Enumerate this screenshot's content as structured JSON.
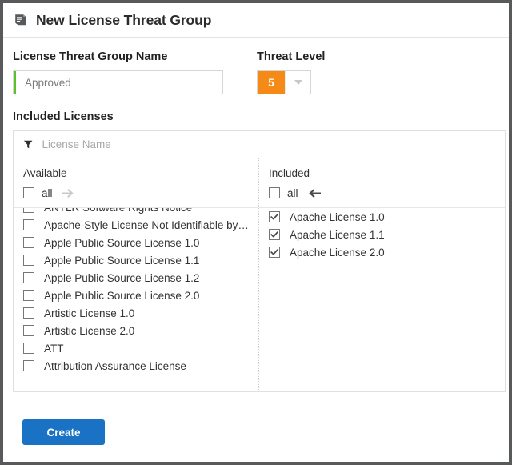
{
  "window": {
    "title": "New License Threat Group",
    "title_icon": "book-icon"
  },
  "form": {
    "name_field": {
      "label": "License Threat Group Name",
      "value": "Approved",
      "placeholder": "",
      "validity_color": "#5cc12c"
    },
    "threat_level": {
      "label": "Threat Level",
      "value": "5",
      "badge_color": "#f68a16",
      "caret_icon": "chevron-down-icon"
    }
  },
  "picker": {
    "section_label": "Included Licenses",
    "filter": {
      "icon": "filter-icon",
      "value": "",
      "placeholder": "License Name"
    },
    "available": {
      "title": "Available",
      "all_label": "all",
      "all_checked": false,
      "move_icon": "arrow-right-icon",
      "move_enabled": false,
      "items": [
        {
          "label": "ANTLR Software Rights Notice",
          "checked": false
        },
        {
          "label": "Apache-Style License Not Identifiable by ...",
          "checked": false
        },
        {
          "label": "Apple Public Source License 1.0",
          "checked": false
        },
        {
          "label": "Apple Public Source License 1.1",
          "checked": false
        },
        {
          "label": "Apple Public Source License 1.2",
          "checked": false
        },
        {
          "label": "Apple Public Source License 2.0",
          "checked": false
        },
        {
          "label": "Artistic License 1.0",
          "checked": false
        },
        {
          "label": "Artistic License 2.0",
          "checked": false
        },
        {
          "label": "ATT",
          "checked": false
        },
        {
          "label": "Attribution Assurance License",
          "checked": false
        }
      ]
    },
    "included": {
      "title": "Included",
      "all_label": "all",
      "all_checked": false,
      "move_icon": "arrow-left-icon",
      "move_enabled": true,
      "items": [
        {
          "label": "Apache License 1.0",
          "checked": true
        },
        {
          "label": "Apache License 1.1",
          "checked": true
        },
        {
          "label": "Apache License 2.0",
          "checked": true
        }
      ]
    }
  },
  "footer": {
    "create_label": "Create",
    "create_color": "#1a72c4"
  }
}
